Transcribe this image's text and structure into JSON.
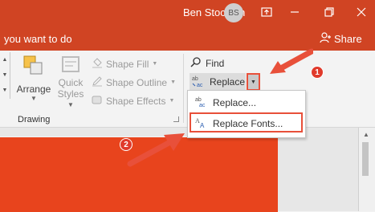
{
  "titlebar": {
    "user_name": "Ben Stockton",
    "user_initials": "BS",
    "search_prompt": "you want to do",
    "share_label": "Share"
  },
  "ribbon": {
    "arrange_label": "Arrange",
    "quick_styles_label_1": "Quick",
    "quick_styles_label_2": "Styles",
    "shape_fill_label": "Shape Fill",
    "shape_outline_label": "Shape Outline",
    "shape_effects_label": "Shape Effects",
    "group_label": "Drawing",
    "find_label": "Find",
    "replace_label": "Replace"
  },
  "dropdown": {
    "items": [
      {
        "label": "Replace..."
      },
      {
        "label": "Replace Fonts..."
      }
    ]
  },
  "annotations": {
    "badge_1": "1",
    "badge_2": "2"
  },
  "colors": {
    "accent": "#d04423",
    "slide": "#e8441d",
    "callout": "#e8503a"
  }
}
